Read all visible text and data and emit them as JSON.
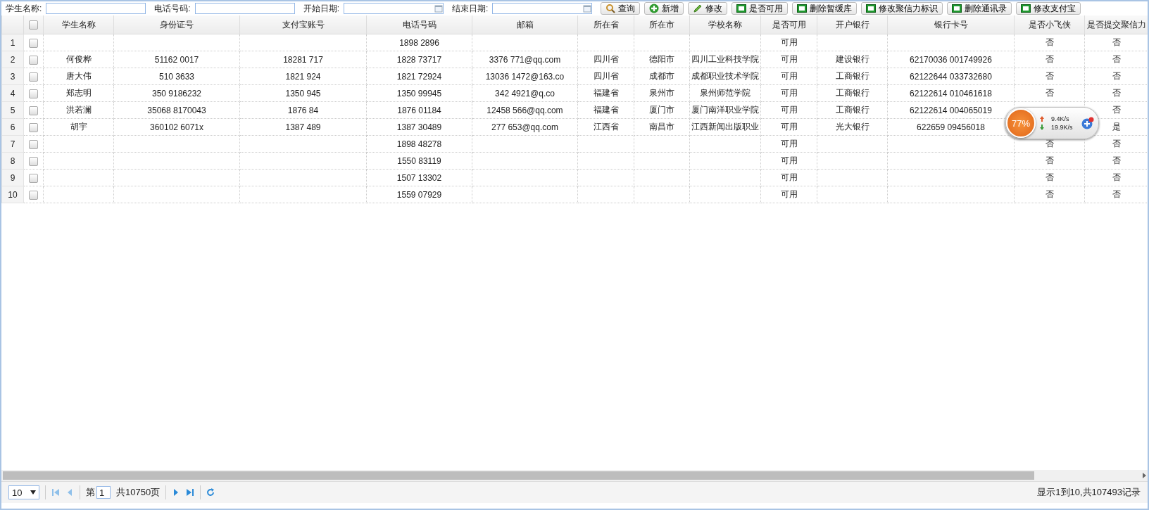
{
  "toolbar": {
    "fields": [
      {
        "label": "学生名称:",
        "kind": "text"
      },
      {
        "label": "电话号码:",
        "kind": "text"
      },
      {
        "label": "开始日期:",
        "kind": "date"
      },
      {
        "label": "结束日期:",
        "kind": "date"
      }
    ],
    "buttons": [
      {
        "label": "查询",
        "kind": "search"
      },
      {
        "label": "新增",
        "kind": "add"
      },
      {
        "label": "修改",
        "kind": "edit"
      },
      {
        "label": "是否可用",
        "kind": "square"
      },
      {
        "label": "删除暂缓库",
        "kind": "square"
      },
      {
        "label": "修改聚信力标识",
        "kind": "square"
      },
      {
        "label": "删除通讯录",
        "kind": "square"
      },
      {
        "label": "修改支付宝",
        "kind": "square"
      }
    ]
  },
  "grid": {
    "columns": [
      "学生名称",
      "身份证号",
      "支付宝账号",
      "电话号码",
      "邮箱",
      "所在省",
      "所在市",
      "学校名称",
      "是否可用",
      "开户银行",
      "银行卡号",
      "是否小飞侠",
      "是否提交聚信力"
    ],
    "header_checked": false,
    "rows": [
      {
        "number": "1",
        "checked": false,
        "phone": "1898 2896",
        "available": "可用",
        "is_xiaofeixia": "否",
        "submitted_jxl": "否"
      },
      {
        "number": "2",
        "checked": false,
        "student_name": "何俊桦",
        "id_number": "51162 0017",
        "alipay_account": "18281 717",
        "phone": "1828 73717",
        "email": "3376 771@qq.com",
        "province": "四川省",
        "city": "德阳市",
        "school": "四川工业科技学院",
        "available": "可用",
        "bank": "建设银行",
        "card_number": "62170036 001749926",
        "is_xiaofeixia": "否",
        "submitted_jxl": "否"
      },
      {
        "number": "3",
        "checked": false,
        "student_name": "唐大伟",
        "id_number": "510 3633",
        "alipay_account": "1821 924",
        "phone": "1821 72924",
        "email": "13036 1472@163.co",
        "province": "四川省",
        "city": "成都市",
        "school": "成都职业技术学院",
        "available": "可用",
        "bank": "工商银行",
        "card_number": "62122644 033732680",
        "is_xiaofeixia": "否",
        "submitted_jxl": "否"
      },
      {
        "number": "4",
        "checked": false,
        "student_name": "郑志明",
        "id_number": "350 9186232",
        "alipay_account": "1350 945",
        "phone": "1350 99945",
        "email": "342 4921@q.co",
        "province": "福建省",
        "city": "泉州市",
        "school": "泉州师范学院",
        "available": "可用",
        "bank": "工商银行",
        "card_number": "62122614 010461618",
        "is_xiaofeixia": "否",
        "submitted_jxl": "否"
      },
      {
        "number": "5",
        "checked": false,
        "student_name": "洪若澜",
        "id_number": "35068 8170043",
        "alipay_account": "1876 84",
        "phone": "1876 01184",
        "email": "12458 566@qq.com",
        "province": "福建省",
        "city": "厦门市",
        "school": "厦门南洋职业学院",
        "available": "可用",
        "bank": "工商银行",
        "card_number": "62122614 004065019",
        "submitted_jxl": "否"
      },
      {
        "number": "6",
        "checked": false,
        "student_name": "胡宇",
        "id_number": "360102 6071x",
        "alipay_account": "1387 489",
        "phone": "1387 30489",
        "email": "277 653@qq.com",
        "province": "江西省",
        "city": "南昌市",
        "school": "江西新闻出版职业",
        "available": "可用",
        "bank": "光大银行",
        "card_number": "622659 09456018",
        "submitted_jxl": "是"
      },
      {
        "number": "7",
        "checked": false,
        "phone": "1898 48278",
        "available": "可用",
        "is_xiaofeixia": "否",
        "submitted_jxl": "否"
      },
      {
        "number": "8",
        "checked": false,
        "phone": "1550 83119",
        "available": "可用",
        "is_xiaofeixia": "否",
        "submitted_jxl": "否"
      },
      {
        "number": "9",
        "checked": false,
        "phone": "1507 13302",
        "available": "可用",
        "is_xiaofeixia": "否",
        "submitted_jxl": "否"
      },
      {
        "number": "10",
        "checked": false,
        "phone": "1559 07929",
        "available": "可用",
        "is_xiaofeixia": "否",
        "submitted_jxl": "否"
      }
    ]
  },
  "pager": {
    "page_size": "10",
    "page_prefix": "第",
    "page": "1",
    "total_pages": "共10750页",
    "status": "显示1到10,共107493记录"
  },
  "net_monitor": {
    "percent": "77%",
    "upload": "9.4K/s",
    "download": "19.9K/s"
  }
}
